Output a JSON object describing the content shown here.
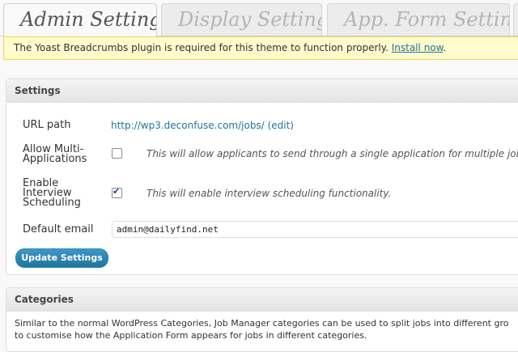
{
  "tabs": [
    {
      "label": "Admin Settings"
    },
    {
      "label": "Display Settings"
    },
    {
      "label": "App. Form Settings"
    }
  ],
  "notice": {
    "text": "The Yoast Breadcrumbs plugin is required for this theme to function properly.",
    "link": "Install now",
    "suffix": "."
  },
  "settings": {
    "title": "Settings",
    "url_path_label": "URL path",
    "url_value": "http://wp3.deconfuse.com/jobs/",
    "url_edit": "(edit)",
    "multi_label_1": "Allow Multi-",
    "multi_label_2": "Applications",
    "multi_checked": false,
    "multi_desc": "This will allow applicants to send through a single application for multiple jobs.",
    "interview_label_1": "Enable",
    "interview_label_2": "Interview",
    "interview_label_3": "Scheduling",
    "interview_checked": true,
    "interview_desc": "This will enable interview scheduling functionality.",
    "email_label": "Default email",
    "email_value": "admin@dailyfind.net",
    "button": "Update Settings"
  },
  "categories": {
    "title": "Categories",
    "line1": "Similar to the normal WordPress Categories, Job Manager categories can be used to split jobs into different gro",
    "line2": "to customise how the Application Form appears for jobs in different categories."
  }
}
